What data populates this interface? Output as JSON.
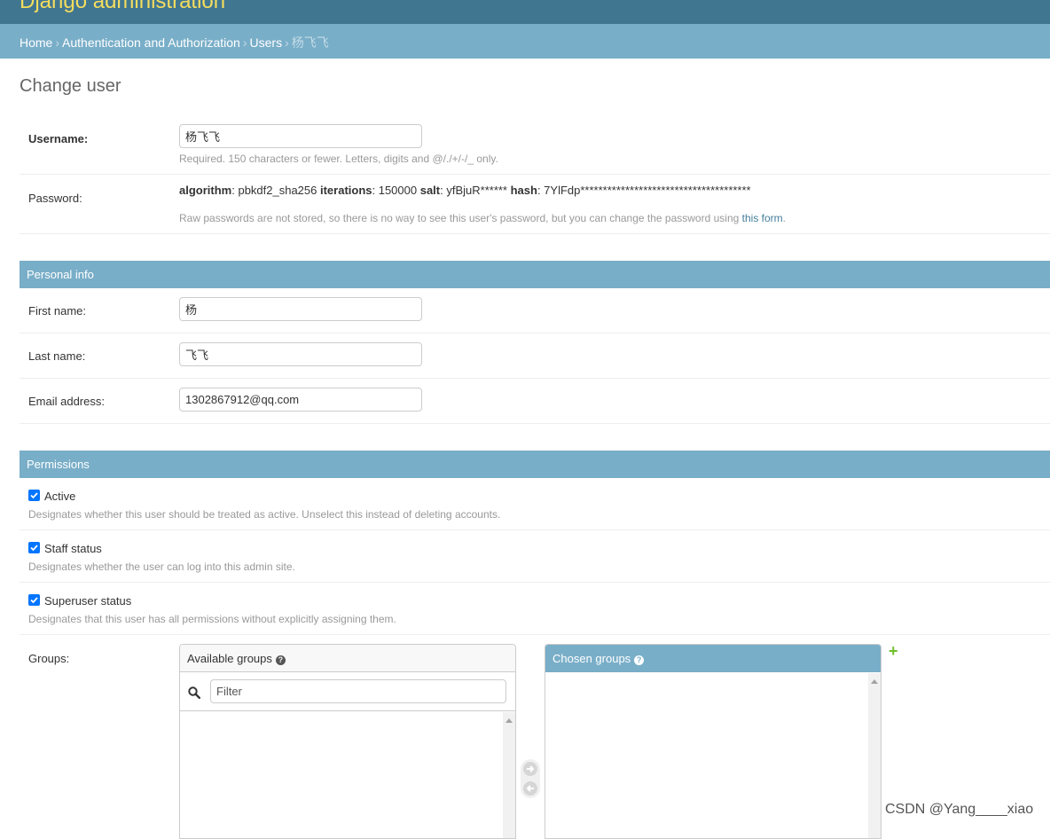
{
  "header": {
    "site_name": "Django administration"
  },
  "breadcrumbs": {
    "home": "Home",
    "app": "Authentication and Authorization",
    "model": "Users",
    "current": "杨飞飞",
    "separator": "›"
  },
  "page": {
    "title": "Change user"
  },
  "fields": {
    "username": {
      "label": "Username:",
      "value": "杨飞飞",
      "help": "Required. 150 characters or fewer. Letters, digits and @/./+/-/_ only."
    },
    "password": {
      "label": "Password:",
      "algorithm_label": "algorithm",
      "algorithm_value": ": pbkdf2_sha256 ",
      "iterations_label": "iterations",
      "iterations_value": ": 150000 ",
      "salt_label": "salt",
      "salt_value": ": yfBjuR****** ",
      "hash_label": "hash",
      "hash_value": ": 7YlFdp**************************************",
      "help_text": "Raw passwords are not stored, so there is no way to see this user's password, but you can change the password using ",
      "help_link": "this form",
      "help_end": "."
    }
  },
  "personal_info": {
    "heading": "Personal info",
    "first_name": {
      "label": "First name:",
      "value": "杨"
    },
    "last_name": {
      "label": "Last name:",
      "value": "飞飞"
    },
    "email": {
      "label": "Email address:",
      "value": "1302867912@qq.com"
    }
  },
  "permissions": {
    "heading": "Permissions",
    "active": {
      "label": "Active",
      "checked": true,
      "help": "Designates whether this user should be treated as active. Unselect this instead of deleting accounts."
    },
    "staff": {
      "label": "Staff status",
      "checked": true,
      "help": "Designates whether the user can log into this admin site."
    },
    "superuser": {
      "label": "Superuser status",
      "checked": true,
      "help": "Designates that this user has all permissions without explicitly assigning them."
    },
    "groups": {
      "label": "Groups:",
      "available_title": "Available groups",
      "chosen_title": "Chosen groups",
      "filter_placeholder": "Filter",
      "help_icon": "?",
      "add_icon": "+"
    }
  },
  "colors": {
    "header_bg": "#417690",
    "site_name": "#f5dd5d",
    "module_bg": "#79aec8",
    "link": "#447e9b",
    "add_green": "#70bf2b"
  },
  "watermark": "CSDN @Yang____xiao"
}
